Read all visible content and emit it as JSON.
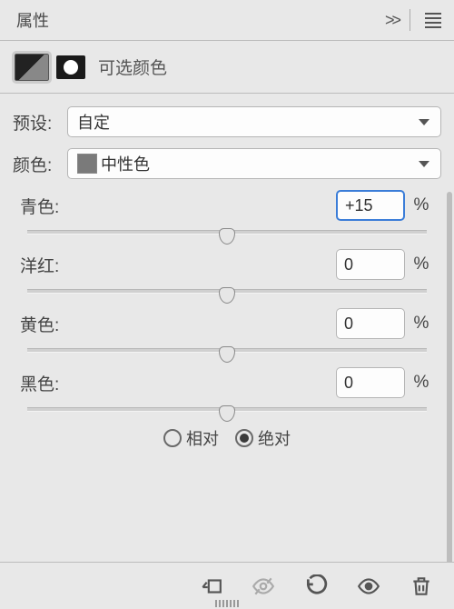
{
  "panel": {
    "title": "属性"
  },
  "adjustment": {
    "title": "可选颜色"
  },
  "preset": {
    "label": "预设:",
    "value": "自定"
  },
  "colors": {
    "label": "颜色:",
    "value": "中性色"
  },
  "sliders": {
    "unit": "%",
    "cyan": {
      "label": "青色:",
      "value": "+15"
    },
    "magenta": {
      "label": "洋红:",
      "value": "0"
    },
    "yellow": {
      "label": "黄色:",
      "value": "0"
    },
    "black": {
      "label": "黑色:",
      "value": "0"
    }
  },
  "method": {
    "relative": "相对",
    "absolute": "绝对",
    "selected": "absolute"
  }
}
